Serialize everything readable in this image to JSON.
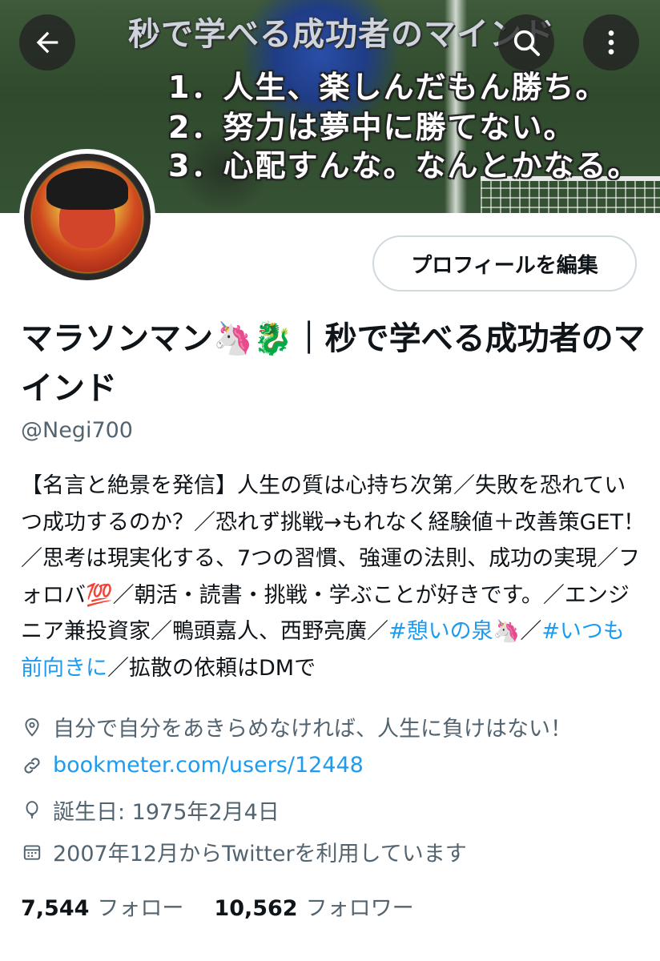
{
  "banner": {
    "title": "秒で学べる成功者のマインド",
    "lines": [
      "1．人生、楽しんだもん勝ち。",
      "2．努力は夢中に勝てない。",
      "3．心配すんな。なんとかなる。"
    ]
  },
  "header": {
    "back_icon": "arrow-left-icon",
    "search_icon": "search-icon",
    "more_icon": "more-vertical-icon"
  },
  "profile": {
    "edit_label": "プロフィールを編集",
    "display_name": "マラソンマン🦄🐉｜秒で学べる成功者のマインド",
    "handle": "@Negi700",
    "bio_text": "【名言と絶景を発信】人生の質は心持ち次第／失敗を恐れていつ成功するのか？／恐れず挑戦→もれなく経験値＋改善策GET！／思考は現実化する、7つの習慣、強運の法則、成功の実現／フォロバ💯／朝活・読書・挑戦・学ぶことが好きです。／エンジニア兼投資家／鴨頭嘉人、西野亮廣／",
    "bio_tag1": "#憩いの泉🦄",
    "bio_sep": "／",
    "bio_tag2": "#いつも前向きに",
    "bio_end": "／拡散の依頼はDMで",
    "location": "自分で自分をあきらめなければ、人生に負けはない！",
    "website": "bookmeter.com/users/12448",
    "birthday": "誕生日: 1975年2月4日",
    "joined": "2007年12月からTwitterを利用しています"
  },
  "stats": {
    "following_count": "7,544",
    "following_label": "フォロー",
    "followers_count": "10,562",
    "followers_label": "フォロワー"
  },
  "colors": {
    "accent": "#1d9bf0",
    "secondary_text": "#536471",
    "primary_text": "#0f1419"
  }
}
